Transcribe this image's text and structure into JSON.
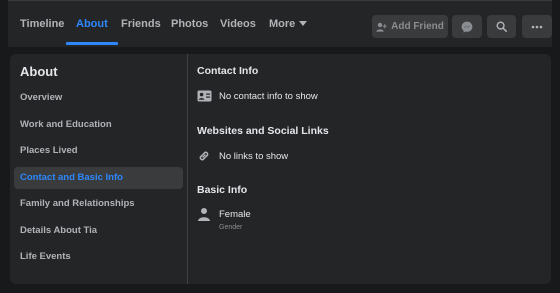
{
  "nav": {
    "tabs": [
      {
        "label": "Timeline"
      },
      {
        "label": "About"
      },
      {
        "label": "Friends"
      },
      {
        "label": "Photos"
      },
      {
        "label": "Videos"
      },
      {
        "label": "More"
      }
    ],
    "add_friend_label": "Add Friend"
  },
  "sidebar": {
    "title": "About",
    "items": [
      {
        "label": "Overview"
      },
      {
        "label": "Work and Education"
      },
      {
        "label": "Places Lived"
      },
      {
        "label": "Contact and Basic Info"
      },
      {
        "label": "Family and Relationships"
      },
      {
        "label": "Details About Tia"
      },
      {
        "label": "Life Events"
      }
    ],
    "active_index": 3
  },
  "main": {
    "contact_title": "Contact Info",
    "contact_empty": "No contact info to show",
    "websites_title": "Websites and Social Links",
    "websites_empty": "No links to show",
    "basic_title": "Basic Info",
    "gender_value": "Female",
    "gender_label": "Gender"
  },
  "colors": {
    "accent": "#2d88ff",
    "background": "#18191a",
    "surface": "#242526"
  },
  "icons": {
    "add_friend": "add-friend-icon",
    "messenger": "messenger-icon",
    "search": "search-icon",
    "more": "ellipsis-icon",
    "contact": "contact-card-icon",
    "links": "link-icon",
    "gender": "person-icon"
  }
}
